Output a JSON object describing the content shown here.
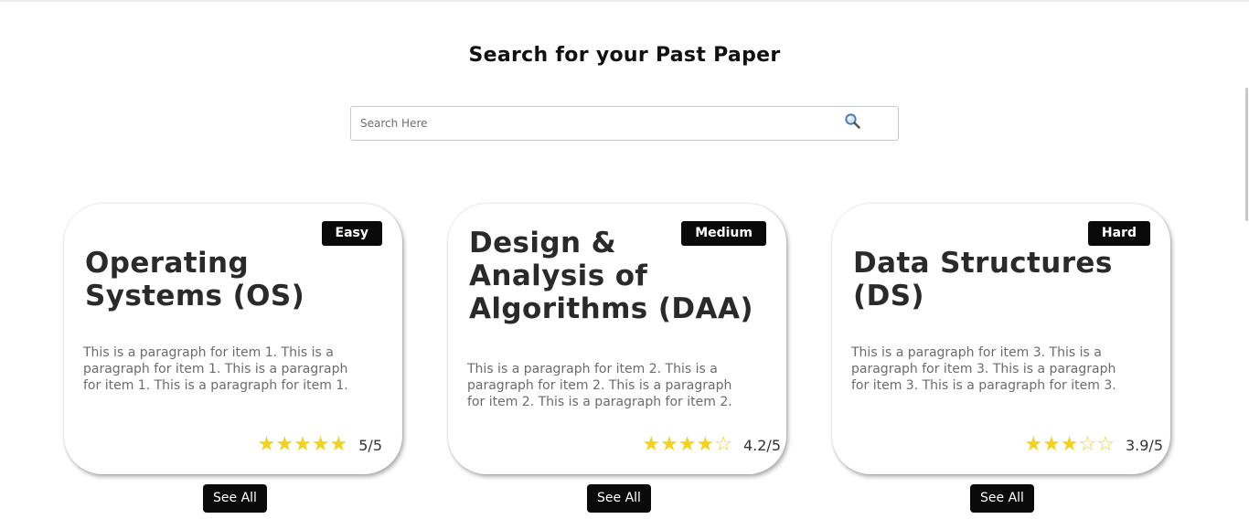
{
  "header": {
    "title": "Search for your Past Paper"
  },
  "search": {
    "placeholder": "Search Here",
    "value": "",
    "icon": "search-icon"
  },
  "cards": [
    {
      "difficulty": "Easy",
      "title": "Operating Systems (OS)",
      "description": "This is a paragraph for item 1. This is a paragraph for item 1. This is a paragraph for item 1. This is a paragraph for item 1.",
      "stars": "★★★★★",
      "rating": "5/5",
      "button_label": "See All"
    },
    {
      "difficulty": "Medium",
      "title": "Design & Analysis of Algorithms (DAA)",
      "description": "This is a paragraph for item 2. This is a paragraph for item 2. This is a paragraph for item 2. This is a paragraph for item 2.",
      "stars": "★★★★☆",
      "rating": "4.2/5",
      "button_label": "See All"
    },
    {
      "difficulty": "Hard",
      "title": "Data Structures (DS)",
      "description": "This is a paragraph for item 3. This is a paragraph for item 3. This is a paragraph for item 3. This is a paragraph for item 3.",
      "stars": "★★★☆☆",
      "rating": "3.9/5",
      "button_label": "See All"
    }
  ],
  "colors": {
    "star": "#f2d21a",
    "badge_bg": "#0a0a0a",
    "button_bg": "#0a0a0a"
  }
}
